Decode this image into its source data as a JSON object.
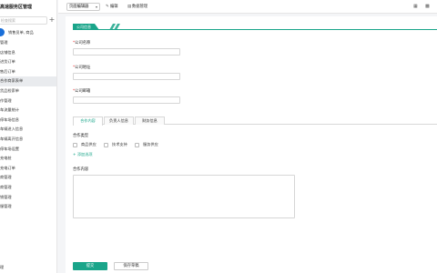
{
  "sidebar": {
    "title": "高速服务区管理",
    "search_placeholder": "检查搜索",
    "add_icon": "+",
    "user_label": "销售员单, 商品",
    "items": [
      {
        "label": "管理"
      },
      {
        "label": "店铺信息"
      },
      {
        "label": "进货订单"
      },
      {
        "label": "售后订单"
      },
      {
        "label": "合作商家表单",
        "active": true
      },
      {
        "label": "货品检索单"
      },
      {
        "label": "作管理"
      },
      {
        "label": "车流量统计"
      },
      {
        "label": "停车场信息"
      },
      {
        "label": "车辆进入信息"
      },
      {
        "label": "车辆离开信息"
      },
      {
        "label": "停车场设置"
      },
      {
        "label": "充电桩"
      },
      {
        "label": "充电订单"
      },
      {
        "label": "商管理"
      },
      {
        "label": "商管理"
      },
      {
        "label": "销管理"
      },
      {
        "label": "服管理"
      }
    ],
    "bottom_label": "理"
  },
  "toolbar": {
    "select_value": "页面编辑器",
    "edit_label": "编辑",
    "data_manage_label": "数据管理",
    "icons": [
      "edit-icon",
      "database-icon",
      "calendar-icon",
      "grid-icon"
    ]
  },
  "form": {
    "header_tag": "公司信息",
    "fields": [
      {
        "label": "公司名称",
        "required": true
      },
      {
        "label": "公司地址",
        "required": true
      },
      {
        "label": "公司邮箱",
        "required": true
      }
    ],
    "tabs": [
      {
        "label": "合作内容",
        "active": true
      },
      {
        "label": "负责人信息",
        "active": false
      },
      {
        "label": "财务信息",
        "active": false
      }
    ],
    "cooperation_type_label": "合作类型",
    "checkboxes": [
      {
        "label": "商品供应"
      },
      {
        "label": "技术支持"
      },
      {
        "label": "服务供应"
      }
    ],
    "add_option_label": "+ 添加选项",
    "cooperation_content_label": "合作内容"
  },
  "footer": {
    "submit_label": "提交",
    "save_draft_label": "保存草稿"
  },
  "colors": {
    "accent": "#1aa58a",
    "user_dot": "#1a6fd9"
  }
}
